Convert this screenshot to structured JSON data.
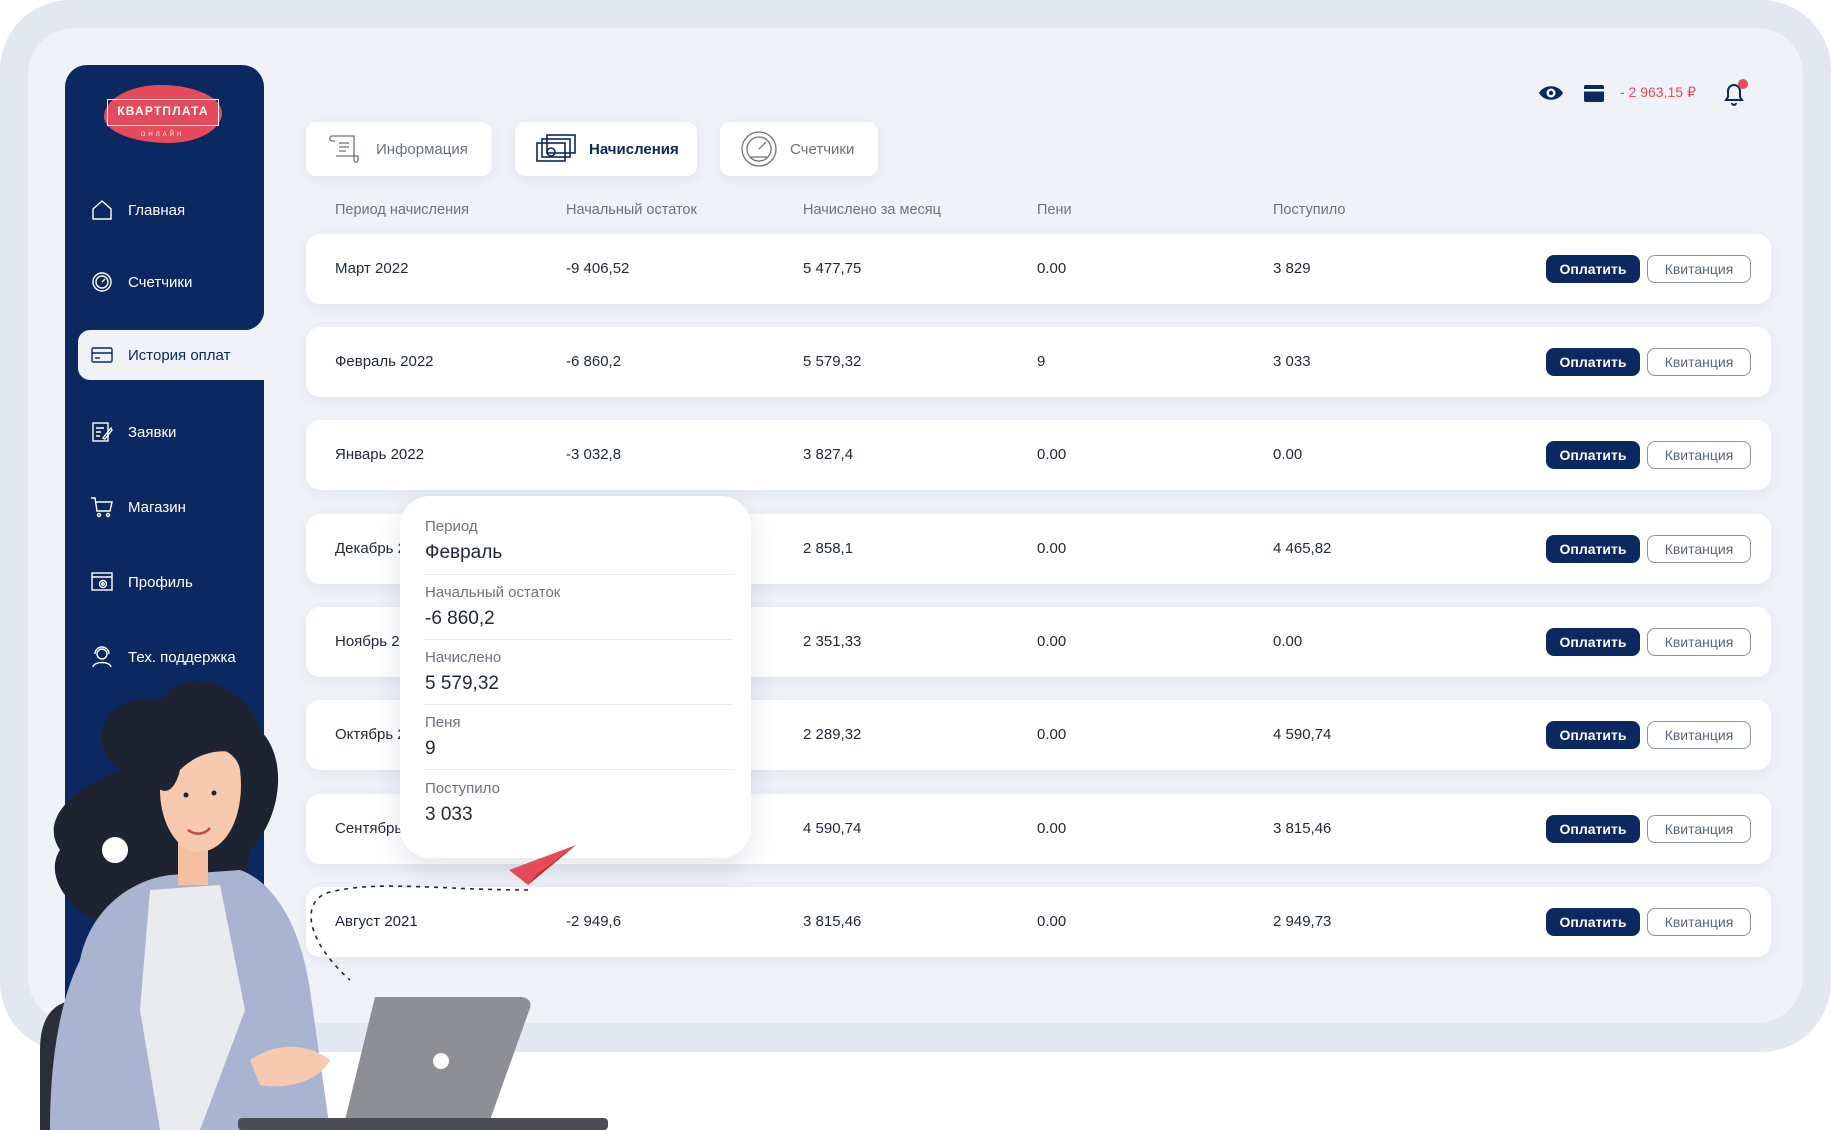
{
  "brand": {
    "logo_text": "КВАРТПЛАТА",
    "logo_sub": "ОНЛАЙН"
  },
  "sidebar": {
    "items": [
      {
        "label": "Главная",
        "icon": "home-icon"
      },
      {
        "label": "Счетчики",
        "icon": "gauge-icon"
      },
      {
        "label": "История оплат",
        "icon": "card-icon",
        "active": true
      },
      {
        "label": "Заявки",
        "icon": "edit-document-icon"
      },
      {
        "label": "Магазин",
        "icon": "cart-icon"
      },
      {
        "label": "Профиль",
        "icon": "profile-settings-icon"
      },
      {
        "label": "Тех. поддержка",
        "icon": "support-agent-icon"
      }
    ]
  },
  "tabs": [
    {
      "label": "Информация",
      "icon": "scroll-icon",
      "active": false
    },
    {
      "label": "Начисления",
      "icon": "money-icon",
      "active": true
    },
    {
      "label": "Счетчики",
      "icon": "meter-icon",
      "active": false
    }
  ],
  "topbar": {
    "balance": "- 2 963,15 ₽",
    "has_notification": true
  },
  "table": {
    "headers": [
      "Период начисления",
      "Начальный остаток",
      "Начислено за месяц",
      "Пени",
      "Поступило"
    ],
    "pay_label": "Оплатить",
    "receipt_label": "Квитанция",
    "rows": [
      {
        "period": "Март 2022",
        "start": "-9 406,52",
        "accrued": "5 477,75",
        "penalty": "0.00",
        "received": "3 829"
      },
      {
        "period": "Февраль 2022",
        "start": "-6 860,2",
        "accrued": "5 579,32",
        "penalty": "9",
        "received": "3 033"
      },
      {
        "period": "Январь 2022",
        "start": "-3 032,8",
        "accrued": "3 827,4",
        "penalty": "0.00",
        "received": "0.00"
      },
      {
        "period": "Декабрь 2",
        "start": "",
        "accrued": "2 858,1",
        "penalty": "0.00",
        "received": "4 465,82"
      },
      {
        "period": "Ноябрь 20",
        "start": "",
        "accrued": "2 351,33",
        "penalty": "0.00",
        "received": "0.00"
      },
      {
        "period": "Октябрь 2",
        "start": "",
        "accrued": "2 289,32",
        "penalty": "0.00",
        "received": "4 590,74"
      },
      {
        "period": "Сентябрь",
        "start": "",
        "accrued": "4 590,74",
        "penalty": "0.00",
        "received": "3 815,46"
      },
      {
        "period": "Август 2021",
        "start": "-2 949,6",
        "accrued": "3 815,46",
        "penalty": "0.00",
        "received": "2 949,73"
      }
    ]
  },
  "tooltip": {
    "fields": [
      {
        "label": "Период",
        "value": "Февраль"
      },
      {
        "label": "Начальный остаток",
        "value": "-6 860,2"
      },
      {
        "label": "Начислено",
        "value": "5 579,32"
      },
      {
        "label": "Пеня",
        "value": "9"
      },
      {
        "label": "Поступило",
        "value": "3 033"
      }
    ]
  },
  "colors": {
    "navy": "#0c2860",
    "accent": "#e54b5a",
    "background": "#eff2f7",
    "frame": "#e3e7ef"
  }
}
